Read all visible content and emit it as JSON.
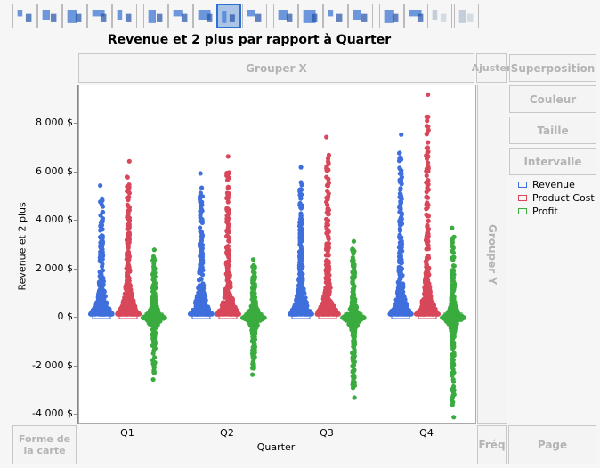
{
  "toolbar": {
    "icons": [
      "points-icon",
      "smoother-icon",
      "line-of-fit-icon",
      "ellipse-icon",
      "contour-icon",
      "line-icon",
      "bar-icon",
      "area-icon",
      "box-plot-icon",
      "histogram-icon",
      "heatmap-icon",
      "pie-icon",
      "treemap-icon",
      "mosaic-icon",
      "caption-box-icon",
      "formula-icon",
      "map-shapes-icon",
      "parallel-icon"
    ],
    "selected": "box-plot-icon"
  },
  "zones": {
    "group_x": "Grouper X",
    "fit": "Ajuster",
    "overlay": "Superposition",
    "color": "Couleur",
    "size": "Taille",
    "interval": "Intervalle",
    "group_y": "Grouper Y",
    "map_shape": "Forme de la carte",
    "freq": "Fréq",
    "page": "Page"
  },
  "chart_data": {
    "type": "scatter",
    "title": "Revenue et 2 plus par rapport à Quarter",
    "xlabel": "Quarter",
    "ylabel": "Revenue et 2 plus",
    "categories": [
      "Q1",
      "Q2",
      "Q3",
      "Q4"
    ],
    "ylim": [
      -4400,
      9580
    ],
    "yticks": [
      {
        "v": 8000,
        "label": "8 000 $"
      },
      {
        "v": 6000,
        "label": "6 000 $"
      },
      {
        "v": 4000,
        "label": "4 000 $"
      },
      {
        "v": 2000,
        "label": "2 000 $"
      },
      {
        "v": 0,
        "label": "0 $"
      },
      {
        "v": -2000,
        "label": "-2 000 $"
      },
      {
        "v": -4000,
        "label": "-4 000 $"
      }
    ],
    "series": [
      {
        "name": "Revenue",
        "color": "#3f6fdc",
        "max": [
          5450,
          5950,
          6200,
          7550
        ],
        "min": [
          0,
          0,
          0,
          0
        ]
      },
      {
        "name": "Product Cost",
        "color": "#d8475a",
        "max": [
          6450,
          6650,
          7450,
          9200
        ],
        "min": [
          0,
          0,
          0,
          0
        ]
      },
      {
        "name": "Profit",
        "color": "#3aab3e",
        "max": [
          2800,
          2400,
          3150,
          3700
        ],
        "min": [
          -2550,
          -2350,
          -3300,
          -4100
        ]
      }
    ]
  }
}
